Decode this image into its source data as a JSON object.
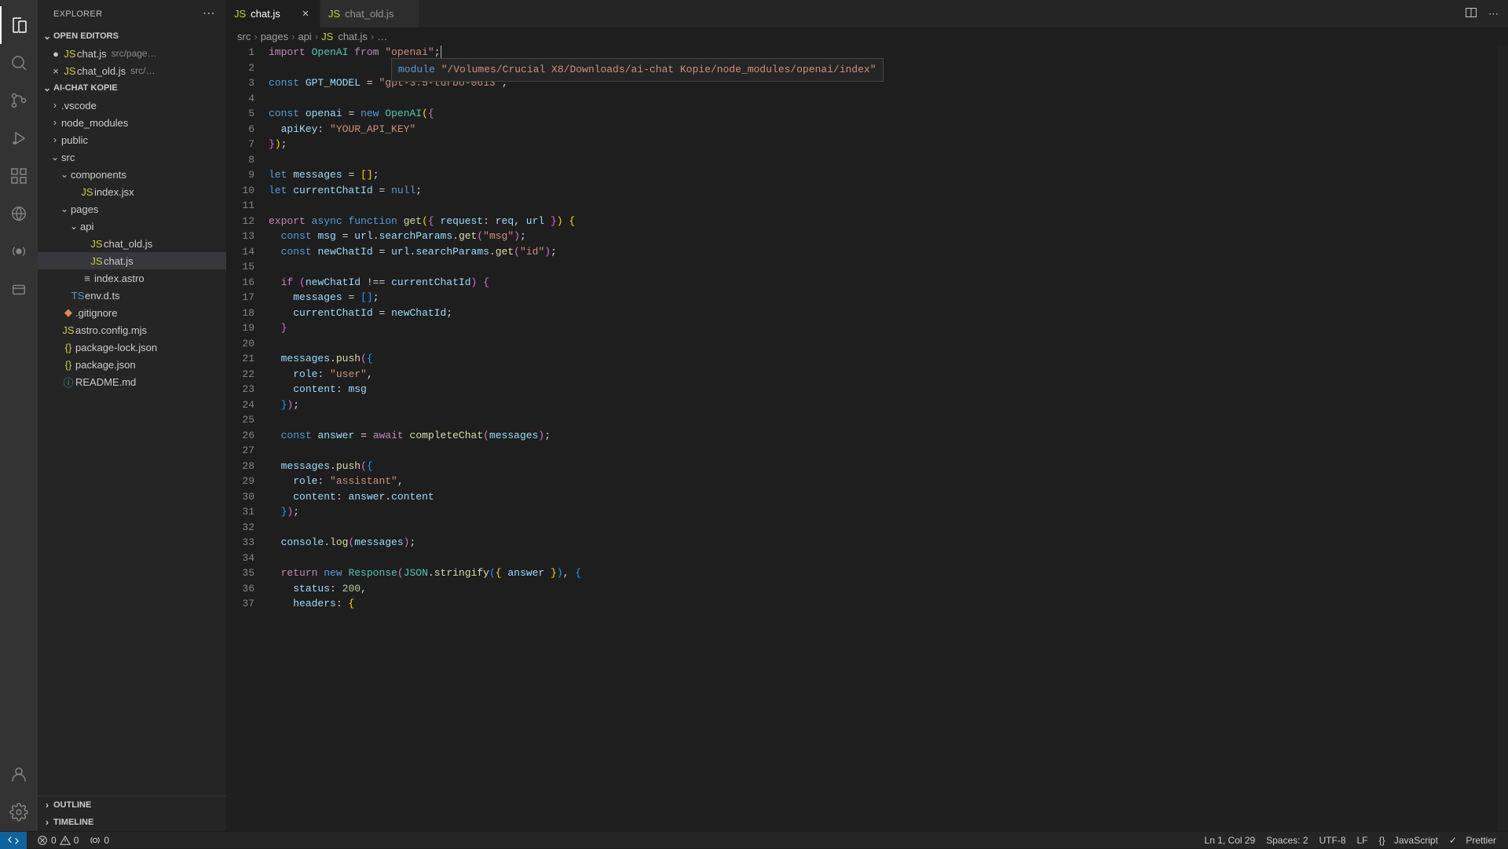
{
  "explorer": {
    "title": "EXPLORER",
    "openEditorsLabel": "OPEN EDITORS",
    "projectLabel": "AI-CHAT KOPIE",
    "outlineLabel": "OUTLINE",
    "timelineLabel": "TIMELINE",
    "openEditors": [
      {
        "name": "chat.js",
        "meta": "src/page…",
        "dirty": true
      },
      {
        "name": "chat_old.js",
        "meta": "src/…",
        "dirty": false
      }
    ],
    "tree": [
      {
        "indent": 1,
        "chev": "›",
        "icon": "",
        "label": ".vscode"
      },
      {
        "indent": 1,
        "chev": "›",
        "icon": "",
        "label": "node_modules"
      },
      {
        "indent": 1,
        "chev": "›",
        "icon": "",
        "label": "public"
      },
      {
        "indent": 1,
        "chev": "⌄",
        "icon": "",
        "label": "src"
      },
      {
        "indent": 2,
        "chev": "⌄",
        "icon": "",
        "label": "components"
      },
      {
        "indent": 3,
        "chev": "",
        "icon": "JS",
        "iconClass": "ic-js",
        "label": "index.jsx"
      },
      {
        "indent": 2,
        "chev": "⌄",
        "icon": "",
        "label": "pages"
      },
      {
        "indent": 3,
        "chev": "⌄",
        "icon": "",
        "label": "api"
      },
      {
        "indent": 4,
        "chev": "",
        "icon": "JS",
        "iconClass": "ic-js",
        "label": "chat_old.js"
      },
      {
        "indent": 4,
        "chev": "",
        "icon": "JS",
        "iconClass": "ic-js",
        "label": "chat.js",
        "selected": true
      },
      {
        "indent": 3,
        "chev": "",
        "icon": "≡",
        "iconClass": "ic-astro",
        "label": "index.astro"
      },
      {
        "indent": 2,
        "chev": "",
        "icon": "TS",
        "iconClass": "ic-ts",
        "label": "env.d.ts"
      },
      {
        "indent": 1,
        "chev": "",
        "icon": "◆",
        "iconClass": "ic-git",
        "label": ".gitignore"
      },
      {
        "indent": 1,
        "chev": "",
        "icon": "JS",
        "iconClass": "ic-js",
        "label": "astro.config.mjs"
      },
      {
        "indent": 1,
        "chev": "",
        "icon": "{}",
        "iconClass": "ic-json",
        "label": "package-lock.json"
      },
      {
        "indent": 1,
        "chev": "",
        "icon": "{}",
        "iconClass": "ic-json",
        "label": "package.json"
      },
      {
        "indent": 1,
        "chev": "",
        "icon": "ⓘ",
        "iconClass": "ic-info",
        "label": "README.md"
      }
    ]
  },
  "tabs": [
    {
      "icon": "JS",
      "label": "chat.js",
      "active": true,
      "close": "×"
    },
    {
      "icon": "JS",
      "label": "chat_old.js",
      "active": false,
      "close": ""
    }
  ],
  "breadcrumbs": {
    "parts": [
      "src",
      "pages",
      "api"
    ],
    "fileIcon": "JS",
    "file": "chat.js",
    "tail": "…"
  },
  "hover": {
    "kw": "module",
    "path": "\"/Volumes/Crucial X8/Downloads/ai-chat Kopie/node_modules/openai/index\""
  },
  "code": {
    "lines": [
      [
        [
          "kw",
          "import"
        ],
        [
          "pn",
          " "
        ],
        [
          "cls",
          "OpenAI"
        ],
        [
          "pn",
          " "
        ],
        [
          "kw",
          "from"
        ],
        [
          "pn",
          " "
        ],
        [
          "str",
          "\"openai\""
        ],
        [
          "pn",
          ";"
        ]
      ],
      [],
      [
        [
          "def",
          "const"
        ],
        [
          "pn",
          " "
        ],
        [
          "id",
          "GPT_MODEL"
        ],
        [
          "pn",
          " "
        ],
        [
          "op",
          "="
        ],
        [
          "pn",
          " "
        ],
        [
          "str",
          "\"gpt-3.5-turbo-0613\""
        ],
        [
          "pn",
          ";"
        ]
      ],
      [],
      [
        [
          "def",
          "const"
        ],
        [
          "pn",
          " "
        ],
        [
          "id",
          "openai"
        ],
        [
          "pn",
          " "
        ],
        [
          "op",
          "="
        ],
        [
          "pn",
          " "
        ],
        [
          "def",
          "new"
        ],
        [
          "pn",
          " "
        ],
        [
          "cls",
          "OpenAI"
        ],
        [
          "br",
          "("
        ],
        [
          "br2",
          "{"
        ]
      ],
      [
        [
          "pn",
          "  "
        ],
        [
          "id",
          "apiKey"
        ],
        [
          "pn",
          ": "
        ],
        [
          "str",
          "\"YOUR_API_KEY\""
        ]
      ],
      [
        [
          "br2",
          "}"
        ],
        [
          "br",
          ")"
        ],
        [
          "pn",
          ";"
        ]
      ],
      [],
      [
        [
          "def",
          "let"
        ],
        [
          "pn",
          " "
        ],
        [
          "id",
          "messages"
        ],
        [
          "pn",
          " "
        ],
        [
          "op",
          "="
        ],
        [
          "pn",
          " "
        ],
        [
          "br",
          "["
        ],
        [
          "br",
          "]"
        ],
        [
          "pn",
          ";"
        ]
      ],
      [
        [
          "def",
          "let"
        ],
        [
          "pn",
          " "
        ],
        [
          "id",
          "currentChatId"
        ],
        [
          "pn",
          " "
        ],
        [
          "op",
          "="
        ],
        [
          "pn",
          " "
        ],
        [
          "null",
          "null"
        ],
        [
          "pn",
          ";"
        ]
      ],
      [],
      [
        [
          "kw",
          "export"
        ],
        [
          "pn",
          " "
        ],
        [
          "def",
          "async"
        ],
        [
          "pn",
          " "
        ],
        [
          "def",
          "function"
        ],
        [
          "pn",
          " "
        ],
        [
          "fn",
          "get"
        ],
        [
          "br",
          "("
        ],
        [
          "br2",
          "{"
        ],
        [
          "pn",
          " "
        ],
        [
          "id",
          "request"
        ],
        [
          "pn",
          ": "
        ],
        [
          "id",
          "req"
        ],
        [
          "pn",
          ", "
        ],
        [
          "id",
          "url"
        ],
        [
          "pn",
          " "
        ],
        [
          "br2",
          "}"
        ],
        [
          "br",
          ")"
        ],
        [
          "pn",
          " "
        ],
        [
          "br",
          "{"
        ]
      ],
      [
        [
          "pn",
          "  "
        ],
        [
          "def",
          "const"
        ],
        [
          "pn",
          " "
        ],
        [
          "id",
          "msg"
        ],
        [
          "pn",
          " "
        ],
        [
          "op",
          "="
        ],
        [
          "pn",
          " "
        ],
        [
          "id",
          "url"
        ],
        [
          "pn",
          "."
        ],
        [
          "id",
          "searchParams"
        ],
        [
          "pn",
          "."
        ],
        [
          "fn",
          "get"
        ],
        [
          "br2",
          "("
        ],
        [
          "str",
          "\"msg\""
        ],
        [
          "br2",
          ")"
        ],
        [
          "pn",
          ";"
        ]
      ],
      [
        [
          "pn",
          "  "
        ],
        [
          "def",
          "const"
        ],
        [
          "pn",
          " "
        ],
        [
          "id",
          "newChatId"
        ],
        [
          "pn",
          " "
        ],
        [
          "op",
          "="
        ],
        [
          "pn",
          " "
        ],
        [
          "id",
          "url"
        ],
        [
          "pn",
          "."
        ],
        [
          "id",
          "searchParams"
        ],
        [
          "pn",
          "."
        ],
        [
          "fn",
          "get"
        ],
        [
          "br2",
          "("
        ],
        [
          "str",
          "\"id\""
        ],
        [
          "br2",
          ")"
        ],
        [
          "pn",
          ";"
        ]
      ],
      [],
      [
        [
          "pn",
          "  "
        ],
        [
          "kw",
          "if"
        ],
        [
          "pn",
          " "
        ],
        [
          "br2",
          "("
        ],
        [
          "id",
          "newChatId"
        ],
        [
          "pn",
          " "
        ],
        [
          "op",
          "!=="
        ],
        [
          "pn",
          " "
        ],
        [
          "id",
          "currentChatId"
        ],
        [
          "br2",
          ")"
        ],
        [
          "pn",
          " "
        ],
        [
          "br2",
          "{"
        ]
      ],
      [
        [
          "pn",
          "    "
        ],
        [
          "id",
          "messages"
        ],
        [
          "pn",
          " "
        ],
        [
          "op",
          "="
        ],
        [
          "pn",
          " "
        ],
        [
          "br3",
          "["
        ],
        [
          "br3",
          "]"
        ],
        [
          "pn",
          ";"
        ]
      ],
      [
        [
          "pn",
          "    "
        ],
        [
          "id",
          "currentChatId"
        ],
        [
          "pn",
          " "
        ],
        [
          "op",
          "="
        ],
        [
          "pn",
          " "
        ],
        [
          "id",
          "newChatId"
        ],
        [
          "pn",
          ";"
        ]
      ],
      [
        [
          "pn",
          "  "
        ],
        [
          "br2",
          "}"
        ]
      ],
      [],
      [
        [
          "pn",
          "  "
        ],
        [
          "id",
          "messages"
        ],
        [
          "pn",
          "."
        ],
        [
          "fn",
          "push"
        ],
        [
          "br2",
          "("
        ],
        [
          "br3",
          "{"
        ]
      ],
      [
        [
          "pn",
          "    "
        ],
        [
          "id",
          "role"
        ],
        [
          "pn",
          ": "
        ],
        [
          "str",
          "\"user\""
        ],
        [
          "pn",
          ","
        ]
      ],
      [
        [
          "pn",
          "    "
        ],
        [
          "id",
          "content"
        ],
        [
          "pn",
          ": "
        ],
        [
          "id",
          "msg"
        ]
      ],
      [
        [
          "pn",
          "  "
        ],
        [
          "br3",
          "}"
        ],
        [
          "br2",
          ")"
        ],
        [
          "pn",
          ";"
        ]
      ],
      [],
      [
        [
          "pn",
          "  "
        ],
        [
          "def",
          "const"
        ],
        [
          "pn",
          " "
        ],
        [
          "id",
          "answer"
        ],
        [
          "pn",
          " "
        ],
        [
          "op",
          "="
        ],
        [
          "pn",
          " "
        ],
        [
          "kw",
          "await"
        ],
        [
          "pn",
          " "
        ],
        [
          "fn",
          "completeChat"
        ],
        [
          "br2",
          "("
        ],
        [
          "id",
          "messages"
        ],
        [
          "br2",
          ")"
        ],
        [
          "pn",
          ";"
        ]
      ],
      [],
      [
        [
          "pn",
          "  "
        ],
        [
          "id",
          "messages"
        ],
        [
          "pn",
          "."
        ],
        [
          "fn",
          "push"
        ],
        [
          "br2",
          "("
        ],
        [
          "br3",
          "{"
        ]
      ],
      [
        [
          "pn",
          "    "
        ],
        [
          "id",
          "role"
        ],
        [
          "pn",
          ": "
        ],
        [
          "str",
          "\"assistant\""
        ],
        [
          "pn",
          ","
        ]
      ],
      [
        [
          "pn",
          "    "
        ],
        [
          "id",
          "content"
        ],
        [
          "pn",
          ": "
        ],
        [
          "id",
          "answer"
        ],
        [
          "pn",
          "."
        ],
        [
          "id",
          "content"
        ]
      ],
      [
        [
          "pn",
          "  "
        ],
        [
          "br3",
          "}"
        ],
        [
          "br2",
          ")"
        ],
        [
          "pn",
          ";"
        ]
      ],
      [],
      [
        [
          "pn",
          "  "
        ],
        [
          "id",
          "console"
        ],
        [
          "pn",
          "."
        ],
        [
          "fn",
          "log"
        ],
        [
          "br2",
          "("
        ],
        [
          "id",
          "messages"
        ],
        [
          "br2",
          ")"
        ],
        [
          "pn",
          ";"
        ]
      ],
      [],
      [
        [
          "pn",
          "  "
        ],
        [
          "kw",
          "return"
        ],
        [
          "pn",
          " "
        ],
        [
          "def",
          "new"
        ],
        [
          "pn",
          " "
        ],
        [
          "cls",
          "Response"
        ],
        [
          "br2",
          "("
        ],
        [
          "cls",
          "JSON"
        ],
        [
          "pn",
          "."
        ],
        [
          "fn",
          "stringify"
        ],
        [
          "br3",
          "("
        ],
        [
          "br",
          "{"
        ],
        [
          "pn",
          " "
        ],
        [
          "id",
          "answer"
        ],
        [
          "pn",
          " "
        ],
        [
          "br",
          "}"
        ],
        [
          "br3",
          ")"
        ],
        [
          "pn",
          ", "
        ],
        [
          "br3",
          "{"
        ]
      ],
      [
        [
          "pn",
          "    "
        ],
        [
          "id",
          "status"
        ],
        [
          "pn",
          ": "
        ],
        [
          "num",
          "200"
        ],
        [
          "pn",
          ","
        ]
      ],
      [
        [
          "pn",
          "    "
        ],
        [
          "id",
          "headers"
        ],
        [
          "pn",
          ": "
        ],
        [
          "br",
          "{"
        ]
      ]
    ]
  },
  "status": {
    "errors": "0",
    "warnings": "0",
    "ports": "0",
    "cursor": "Ln 1, Col 29",
    "spaces": "Spaces: 2",
    "encoding": "UTF-8",
    "eol": "LF",
    "langIcon": "{}",
    "lang": "JavaScript",
    "prettier": "Prettier"
  }
}
